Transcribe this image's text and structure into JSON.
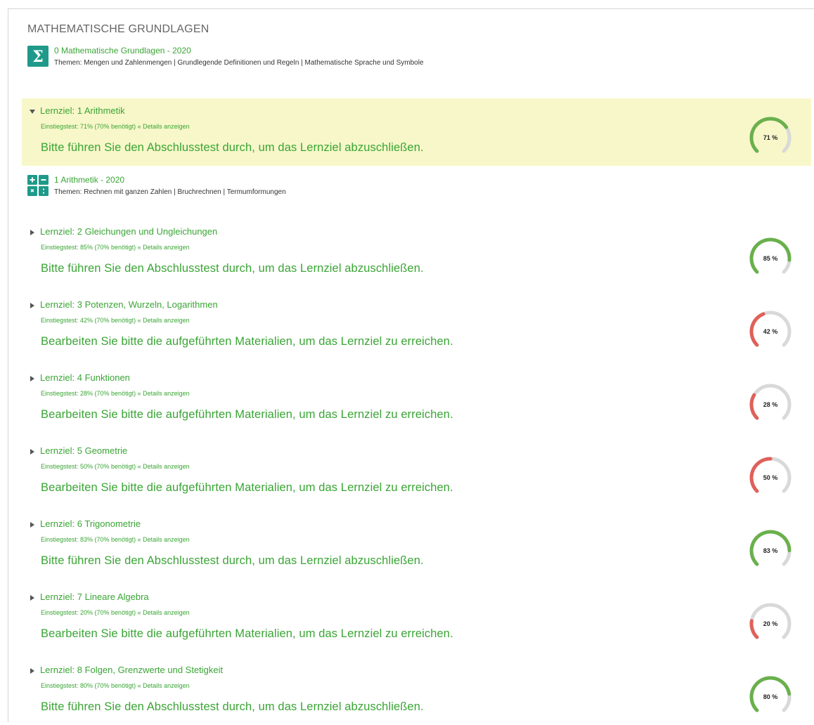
{
  "section": {
    "title": "MATHEMATISCHE GRUNDLAGEN"
  },
  "courses": [
    {
      "title": "0 Mathematische Grundlagen - 2020",
      "topics": "Themen: Mengen und Zahlenmengen | Grundlegende Definitionen und Regeln | Mathematische Sprache und Symbole",
      "icon": "sigma-icon"
    },
    {
      "title": "1 Arithmetik - 2020",
      "topics": "Themen: Rechnen mit ganzen Zahlen | Bruchrechnen | Termumformungen",
      "icon": "arithmetic-operators-icon"
    }
  ],
  "goals": [
    {
      "title": "Lernziel: 1 Arithmetik",
      "test": "Einstiegstest: 71% (70% benötigt)",
      "details": "« Details anzeigen",
      "message": "Bitte führen Sie den Abschlusstest durch, um das Lernziel abzuschließen.",
      "percent": 71,
      "percent_label": "71 %",
      "expanded": true
    },
    {
      "title": "Lernziel: 2 Gleichungen und Ungleichungen",
      "test": "Einstiegstest: 85% (70% benötigt)",
      "details": "« Details anzeigen",
      "message": "Bitte führen Sie den Abschlusstest durch, um das Lernziel abzuschließen.",
      "percent": 85,
      "percent_label": "85 %",
      "expanded": false
    },
    {
      "title": "Lernziel: 3 Potenzen, Wurzeln, Logarithmen",
      "test": "Einstiegstest: 42% (70% benötigt)",
      "details": "« Details anzeigen",
      "message": "Bearbeiten Sie bitte die aufgeführten Materialien, um das Lernziel zu erreichen.",
      "percent": 42,
      "percent_label": "42 %",
      "expanded": false
    },
    {
      "title": "Lernziel: 4 Funktionen",
      "test": "Einstiegstest: 28% (70% benötigt)",
      "details": "« Details anzeigen",
      "message": "Bearbeiten Sie bitte die aufgeführten Materialien, um das Lernziel zu erreichen.",
      "percent": 28,
      "percent_label": "28 %",
      "expanded": false
    },
    {
      "title": "Lernziel: 5 Geometrie",
      "test": "Einstiegstest: 50% (70% benötigt)",
      "details": "« Details anzeigen",
      "message": "Bearbeiten Sie bitte die aufgeführten Materialien, um das Lernziel zu erreichen.",
      "percent": 50,
      "percent_label": "50 %",
      "expanded": false
    },
    {
      "title": "Lernziel: 6 Trigonometrie",
      "test": "Einstiegstest: 83% (70% benötigt)",
      "details": "« Details anzeigen",
      "message": "Bitte führen Sie den Abschlusstest durch, um das Lernziel abzuschließen.",
      "percent": 83,
      "percent_label": "83 %",
      "expanded": false
    },
    {
      "title": "Lernziel: 7 Lineare Algebra",
      "test": "Einstiegstest: 20% (70% benötigt)",
      "details": "« Details anzeigen",
      "message": "Bearbeiten Sie bitte die aufgeführten Materialien, um das Lernziel zu erreichen.",
      "percent": 20,
      "percent_label": "20 %",
      "expanded": false
    },
    {
      "title": "Lernziel: 8 Folgen, Grenzwerte und Stetigkeit",
      "test": "Einstiegstest: 80% (70% benötigt)",
      "details": "« Details anzeigen",
      "message": "Bitte führen Sie den Abschlusstest durch, um das Lernziel abzuschließen.",
      "percent": 80,
      "percent_label": "80 %",
      "expanded": false
    }
  ],
  "colors": {
    "accent": "#3aa535",
    "icon_bg": "#1f9a8a",
    "gauge_pass": "#6ab04c",
    "gauge_fail": "#e0605a",
    "gauge_track": "#d9d9d9",
    "highlight": "#f7f7c9"
  },
  "threshold_percent": 70
}
